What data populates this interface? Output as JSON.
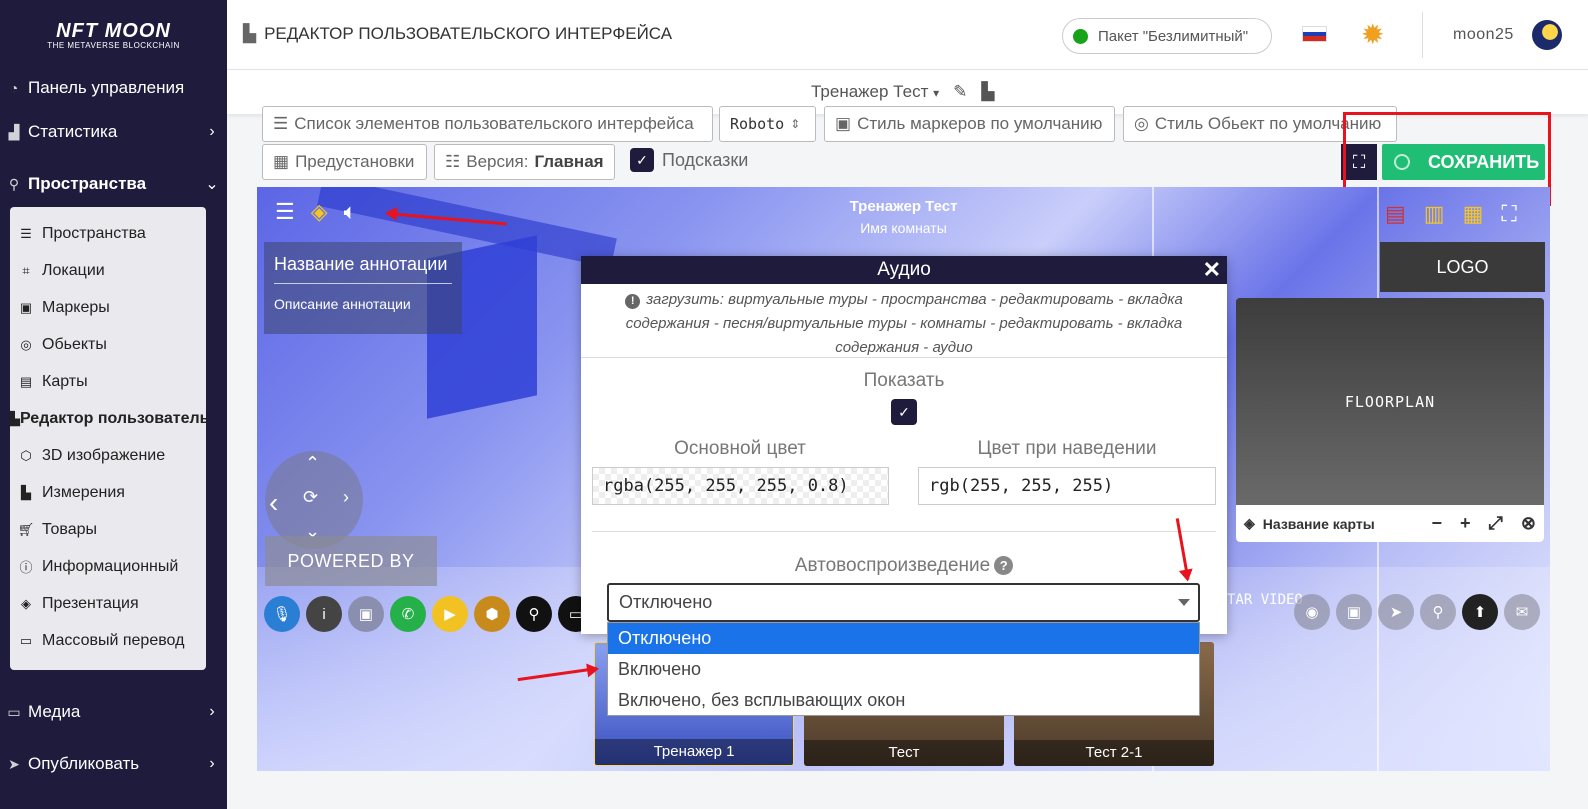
{
  "sidebar": {
    "logo_main": "NFT MOON",
    "logo_sub": "THE METAVERSE BLOCKCHAIN",
    "items": [
      {
        "label": "Панель управления",
        "icon": "dashboard-icon"
      },
      {
        "label": "Статистика",
        "icon": "chart-icon"
      },
      {
        "label": "Пространства",
        "icon": "spaces-icon"
      },
      {
        "label": "Медиа",
        "icon": "monitor-icon"
      },
      {
        "label": "Опубликовать",
        "icon": "send-icon"
      }
    ],
    "submenu": [
      {
        "label": "Пространства",
        "icon": "list-icon"
      },
      {
        "label": "Локации",
        "icon": "location-frame-icon"
      },
      {
        "label": "Маркеры",
        "icon": "image-icon"
      },
      {
        "label": "Обьекты",
        "icon": "target-icon"
      },
      {
        "label": "Карты",
        "icon": "map-icon"
      },
      {
        "label": "Редактор пользовательского интерфейса",
        "icon": "ui-editor-icon"
      },
      {
        "label": "3D изображение",
        "icon": "cube-icon"
      },
      {
        "label": "Измерения",
        "icon": "ruler-icon"
      },
      {
        "label": "Товары",
        "icon": "cart-icon"
      },
      {
        "label": "Информационный",
        "icon": "info-icon"
      },
      {
        "label": "Презентация",
        "icon": "diamond-icon"
      },
      {
        "label": "Массовый перевод",
        "icon": "translate-icon"
      }
    ]
  },
  "header": {
    "title": "РЕДАКТОР ПОЛЬЗОВАТЕЛЬСКОГО ИНТЕРФЕЙСА",
    "package": "Пакет \"Безлимитный\"",
    "username": "moon25"
  },
  "subheader": {
    "project": "Тренажер Тест"
  },
  "toolbar": {
    "elements_list": "Список элементов пользовательского интерфейса",
    "font": "Roboto",
    "marker_style": "Стиль маркеров по умолчанию",
    "object_style": "Стиль Обьект по умолчанию",
    "presets": "Предустановки",
    "version_label": "Версия:",
    "version_value": "Главная",
    "hints": "Подсказки",
    "save": "СОХРАНИТЬ"
  },
  "canvas": {
    "title": "Тренажер Тест",
    "room": "Имя комнаты",
    "annotation_title": "Название аннотации",
    "annotation_desc": "Описание аннотации",
    "powered_by": "POWERED BY",
    "logo": "LOGO",
    "floorplan": "FLOORPLAN",
    "map_name": "Название карты",
    "avatar_video": "TAR VIDEO",
    "thumbnails": [
      "Тренажер 1",
      "Тест",
      "Тест 2-1"
    ]
  },
  "modal": {
    "title": "Аудио",
    "note": "загрузить: виртуальные туры - пространства - редактировать - вкладка содержания - песня/виртуальные туры - комнаты - редактировать - вкладка содержания - аудио",
    "show_label": "Показать",
    "main_color_label": "Основной цвет",
    "main_color_value": "rgba(255, 255, 255, 0.8)",
    "hover_color_label": "Цвет при наведении",
    "hover_color_value": "rgb(255, 255, 255)",
    "autoplay_label": "Автовоспроизведение",
    "autoplay_selected": "Отключено",
    "autoplay_options": [
      "Отключено",
      "Включено",
      "Включено, без всплывающих окон"
    ]
  },
  "colors": {
    "sidebar_bg": "#1f1b3d",
    "save_green": "#1fbe74",
    "highlight_red": "#e8131c",
    "option_selected": "#1a73e8"
  }
}
